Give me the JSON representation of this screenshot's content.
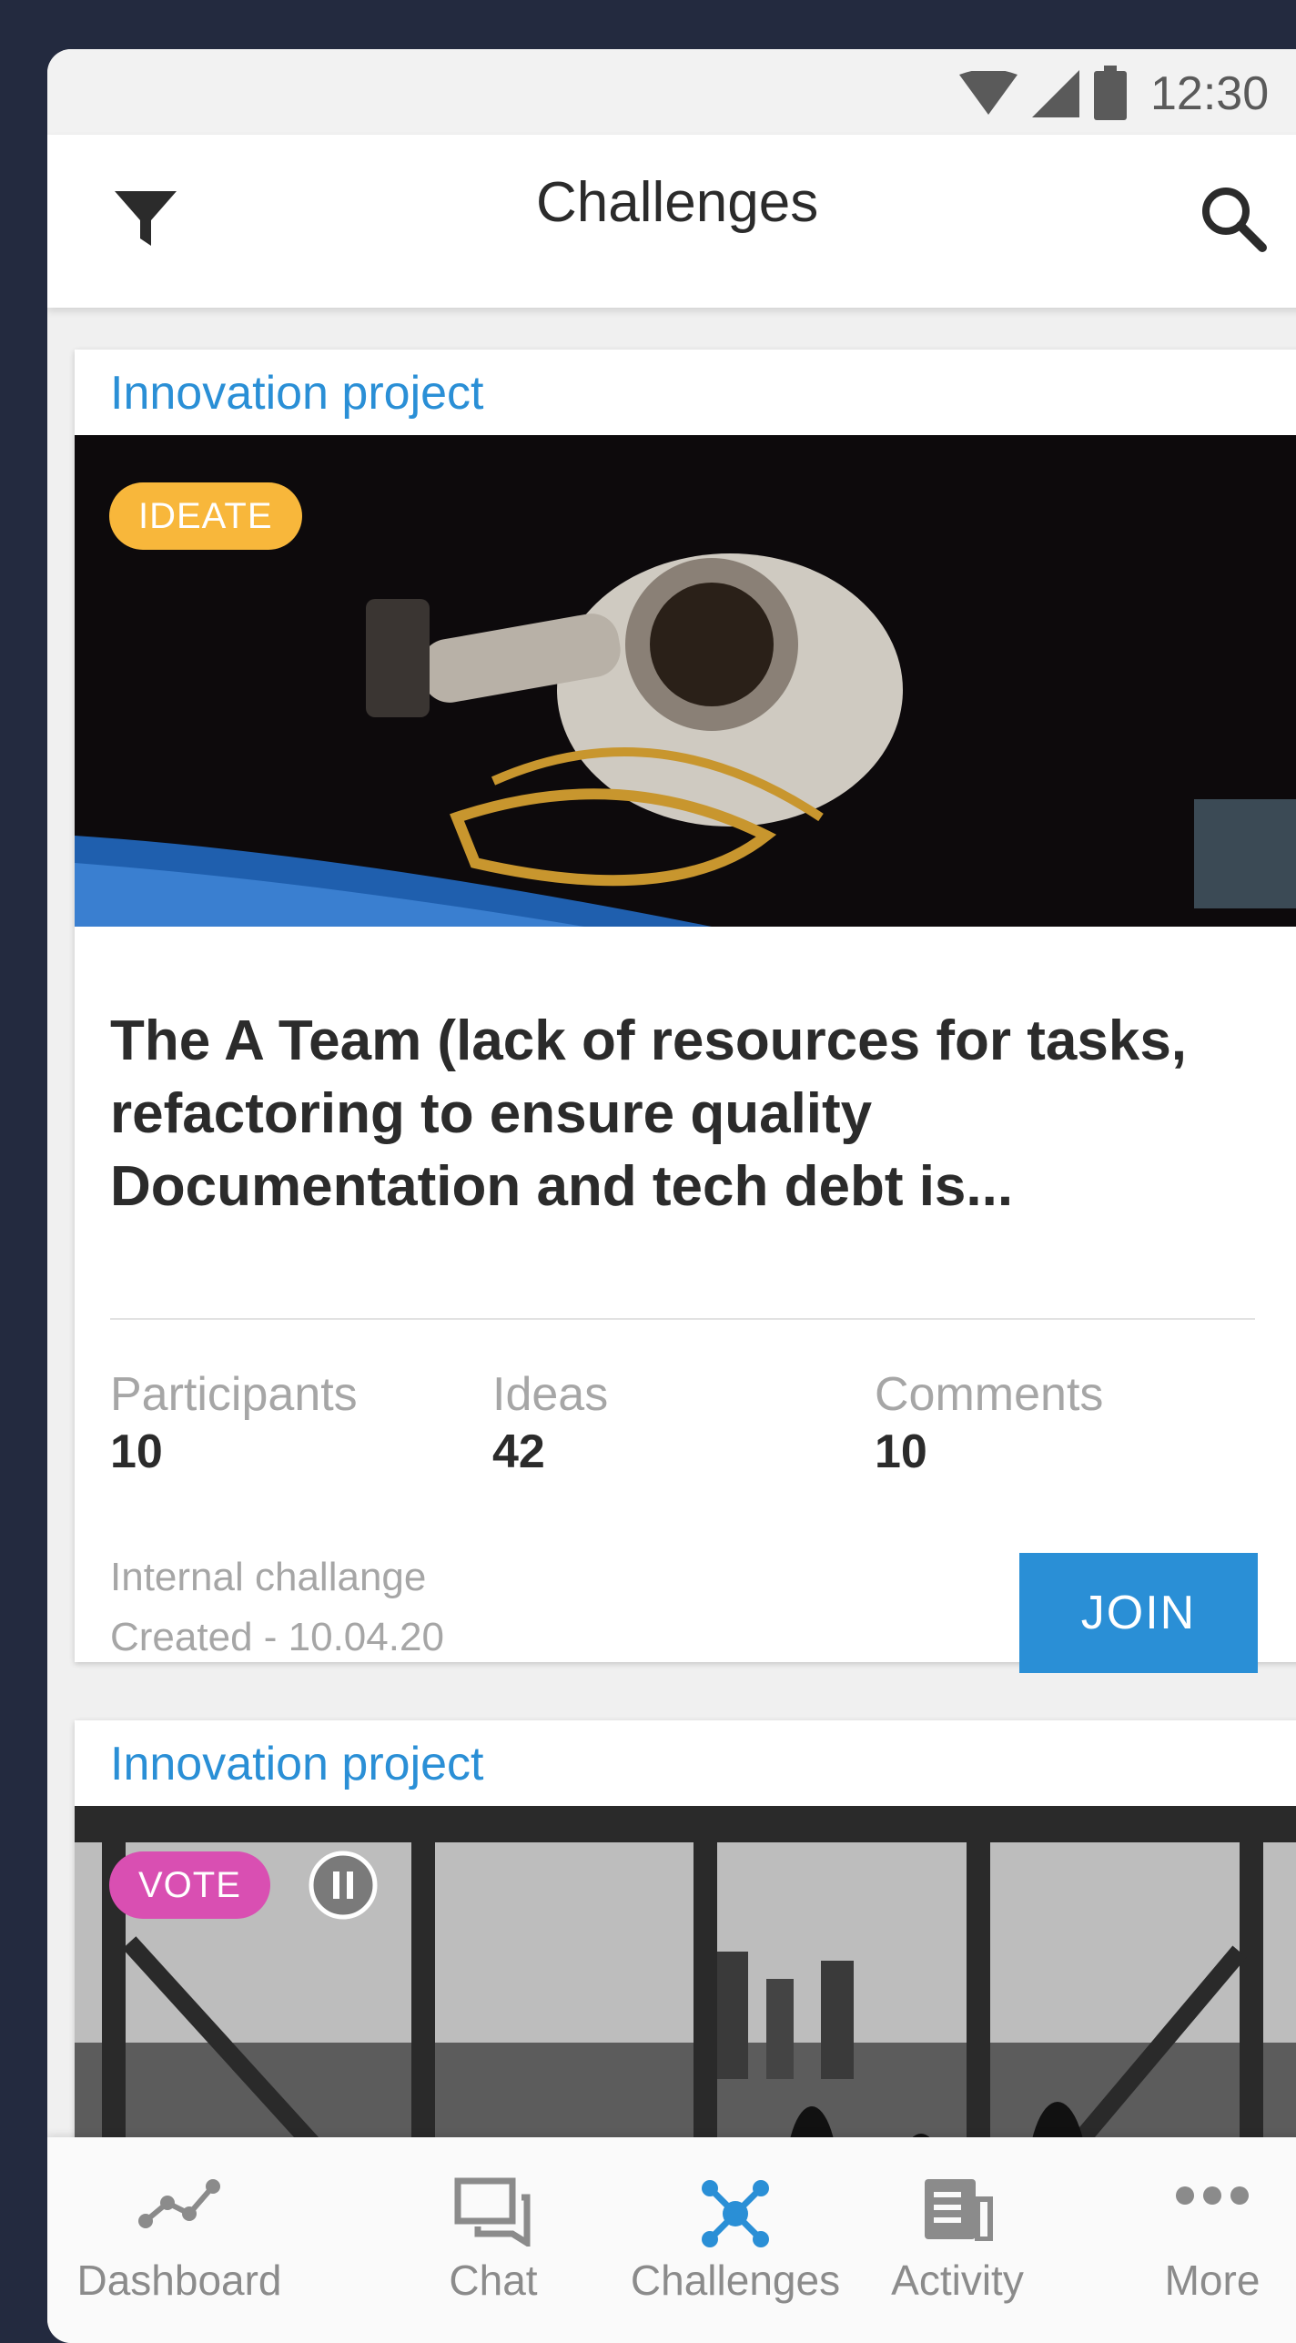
{
  "status_bar": {
    "time": "12:30",
    "icons": [
      "wifi-icon",
      "signal-icon",
      "battery-icon"
    ]
  },
  "app_bar": {
    "title": "Challenges",
    "left_icon": "filter-icon",
    "right_icon": "search-icon"
  },
  "cards": [
    {
      "category": "Innovation project",
      "badge": "IDEATE",
      "badge_color": "#f8b73b",
      "title": "The A Team (lack of resources for tasks, refactoring to ensure quality Documentation and tech debt is...",
      "stats": [
        {
          "label": "Participants",
          "value": "10"
        },
        {
          "label": "Ideas",
          "value": "42"
        },
        {
          "label": "Comments",
          "value": "10"
        }
      ],
      "type": "Internal challange",
      "created": "Created  - 10.04.20",
      "action": "JOIN"
    },
    {
      "category": "Innovation project",
      "badge": "VOTE",
      "badge_color": "#d94fb2",
      "extra_icon": "pause-icon"
    }
  ],
  "bottom_nav": [
    {
      "label": "Dashboard",
      "icon": "dashboard-icon"
    },
    {
      "label": "Chat",
      "icon": "chat-icon"
    },
    {
      "label": "Challenges",
      "icon": "challenges-icon",
      "active": true
    },
    {
      "label": "Activity",
      "icon": "activity-icon"
    },
    {
      "label": "More",
      "icon": "more-icon"
    }
  ],
  "colors": {
    "accent": "#2a8fd6",
    "background": "#232a3f"
  }
}
